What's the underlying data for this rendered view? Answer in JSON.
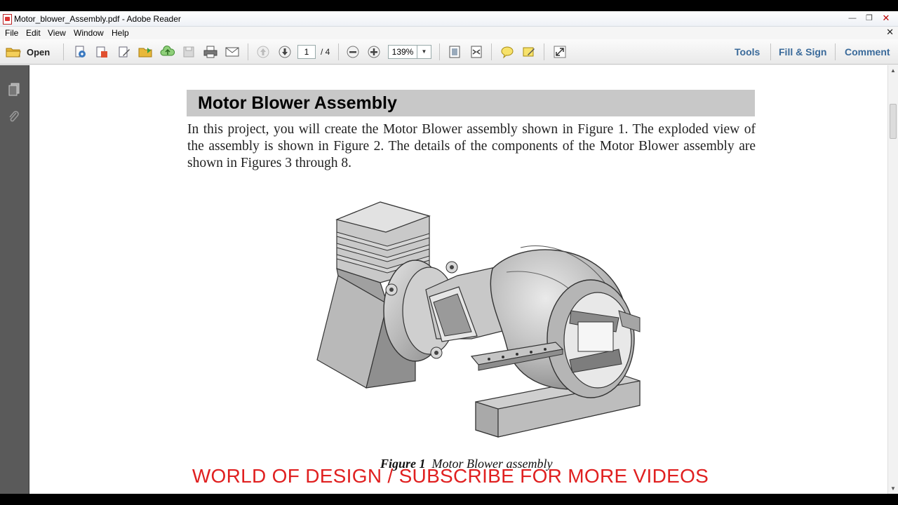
{
  "window": {
    "title": "Motor_blower_Assembly.pdf - Adobe Reader"
  },
  "menu": {
    "items": [
      "File",
      "Edit",
      "View",
      "Window",
      "Help"
    ]
  },
  "toolbar": {
    "open_label": "Open",
    "page_current": "1",
    "page_total": "/ 4",
    "zoom": "139%",
    "right_links": [
      "Tools",
      "Fill & Sign",
      "Comment"
    ]
  },
  "document": {
    "heading": "Motor Blower Assembly",
    "paragraph": "In this project, you will create the Motor Blower assembly shown in Figure 1. The exploded view of the assembly is shown in Figure 2. The details of the components of the Motor Blower assembly are shown in Figures 3 through 8.",
    "caption_label": "Figure 1",
    "caption_text": "Motor Blower assembly"
  },
  "overlay": {
    "watermark": "WORLD OF DESIGN / SUBSCRIBE FOR MORE VIDEOS"
  },
  "colors": {
    "link": "#3a6a9a",
    "watermark": "#e02020",
    "heading_band": "#c8c8c8"
  }
}
